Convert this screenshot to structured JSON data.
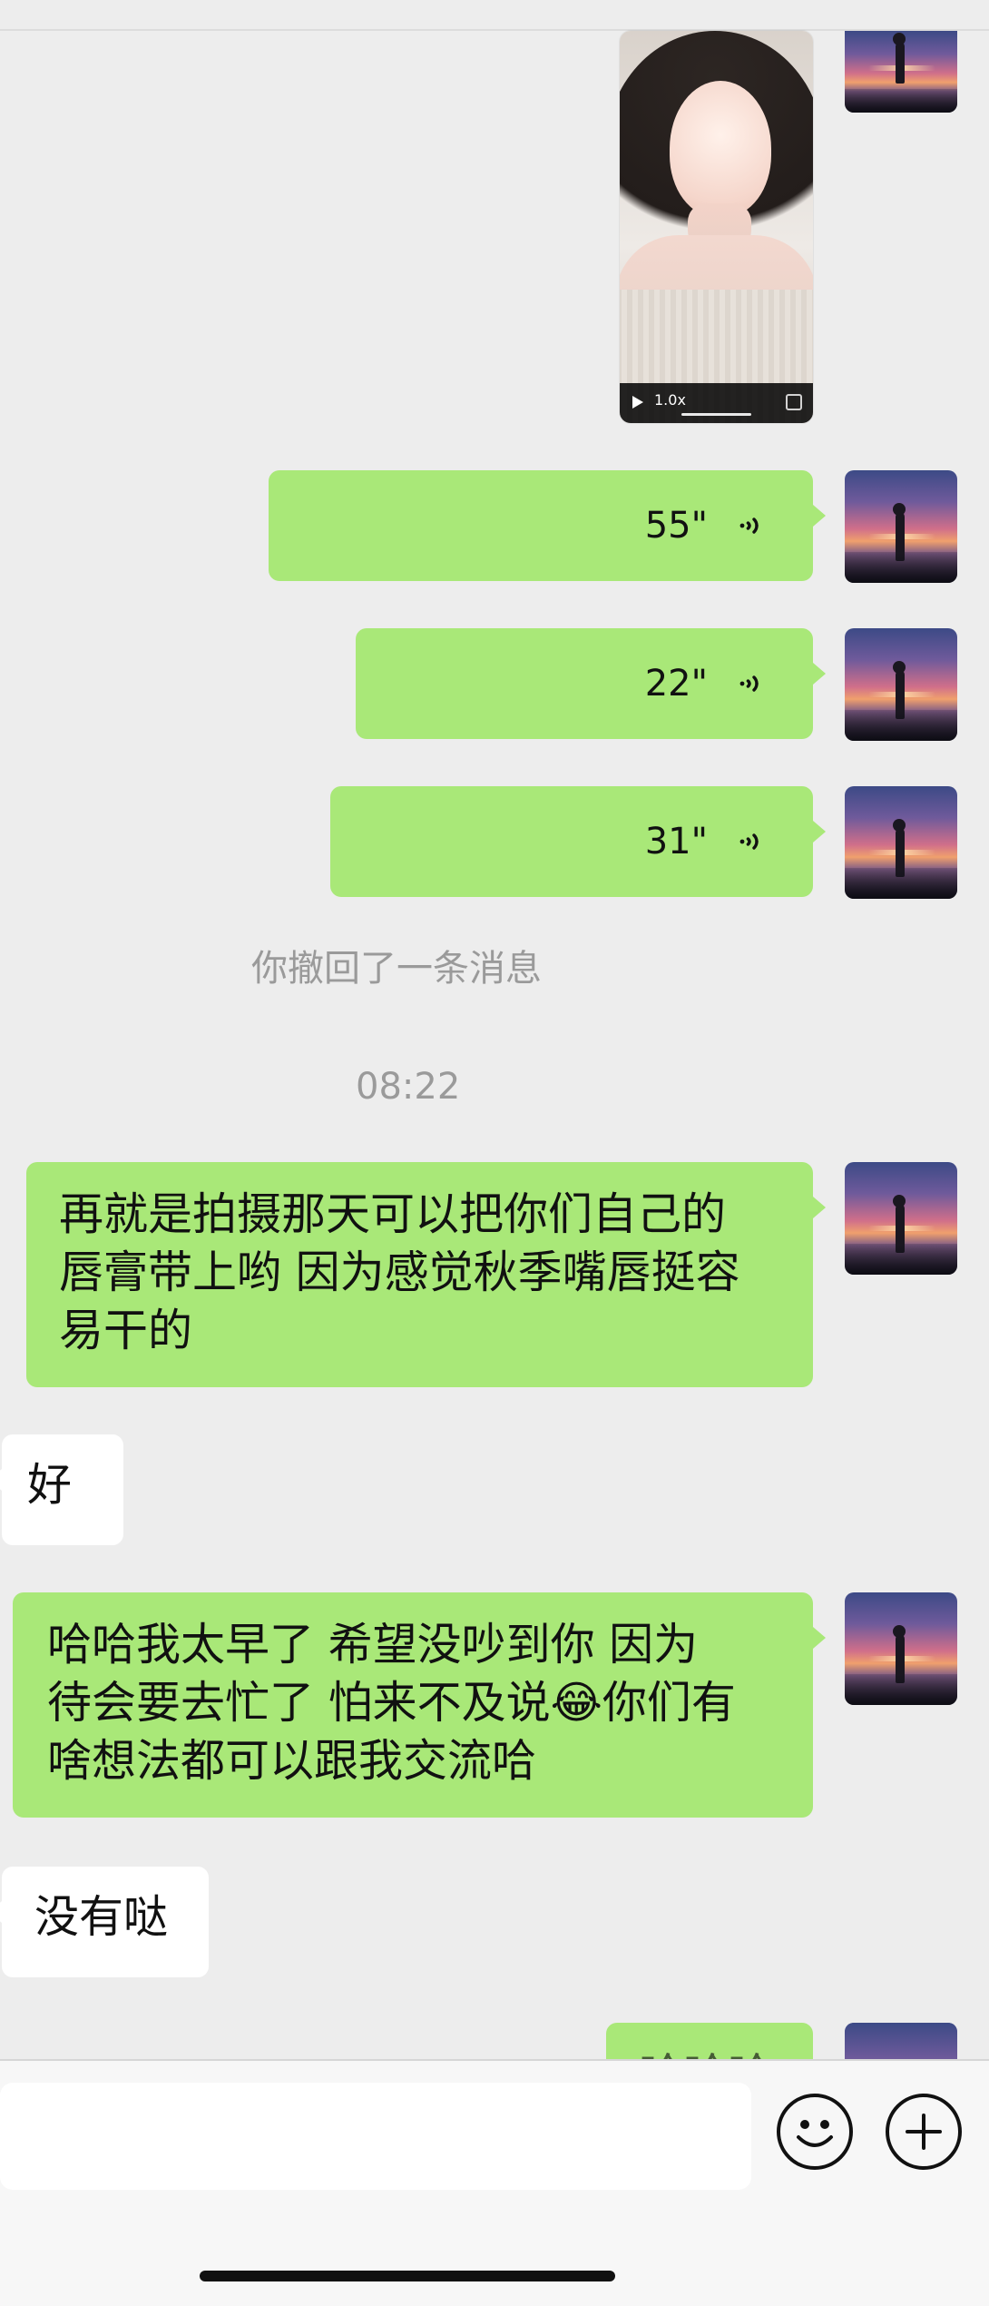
{
  "messages": {
    "voice_1": {
      "duration": "55\""
    },
    "voice_2": {
      "duration": "22\""
    },
    "voice_3": {
      "duration": "31\""
    },
    "system_recall": "你撤回了一条消息",
    "timestamp": "08:22",
    "sent_1_lines": [
      "再就是拍摄那天可以把你们自己的",
      "唇膏带上哟 因为感觉秋季嘴唇挺容",
      "易干的"
    ],
    "recv_1": "好",
    "sent_2_lines": [
      "哈哈我太早了 希望没吵到你  因为",
      "待会要去忙了 怕来不及说",
      "你们有",
      "啥想法都可以跟我交流哈"
    ],
    "recv_2": "没有哒",
    "partial_bottom": "哈哈哈"
  },
  "emoji": {
    "laugh": "😂"
  },
  "video": {
    "speed_label": "1.0x"
  },
  "icons": {
    "voice_wave": "voice-wave-icon",
    "emoji_button": "emoji-face-icon",
    "plus_button": "plus-icon"
  },
  "colors": {
    "background": "#ededed",
    "sent_bubble": "#a9e878",
    "received_bubble": "#ffffff",
    "system_text": "#9a9a9a",
    "input_bar": "#f7f7f7"
  }
}
